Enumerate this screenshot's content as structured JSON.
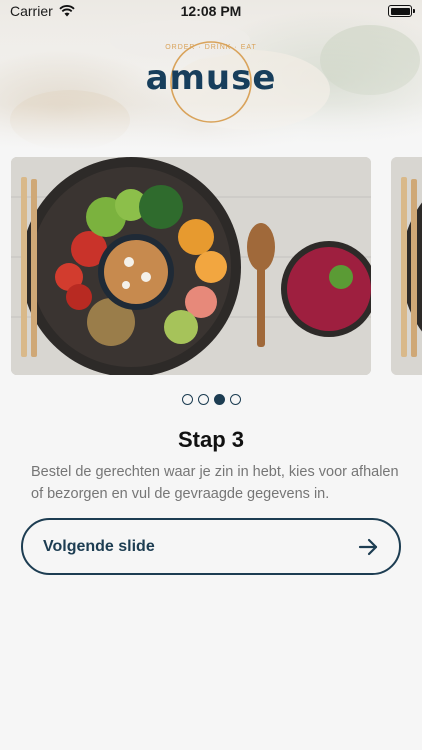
{
  "status_bar": {
    "carrier": "Carrier",
    "time": "12:08 PM"
  },
  "logo": {
    "brand": "amuse",
    "tagline": "ORDER · DRINK · EAT"
  },
  "carousel": {
    "slide_count": 4,
    "active_index": 2
  },
  "step": {
    "title": "Stap 3",
    "description": "Bestel de gerechten waar je zin in hebt, kies voor afhalen of bezorgen en vul de gevraagde gegevens in."
  },
  "next_button": {
    "label": "Volgende slide",
    "icon": "arrow-right-icon"
  },
  "colors": {
    "primary": "#1d3d52",
    "accent": "#d9a35b",
    "background": "#f6f6f6",
    "text_muted": "#767676"
  }
}
